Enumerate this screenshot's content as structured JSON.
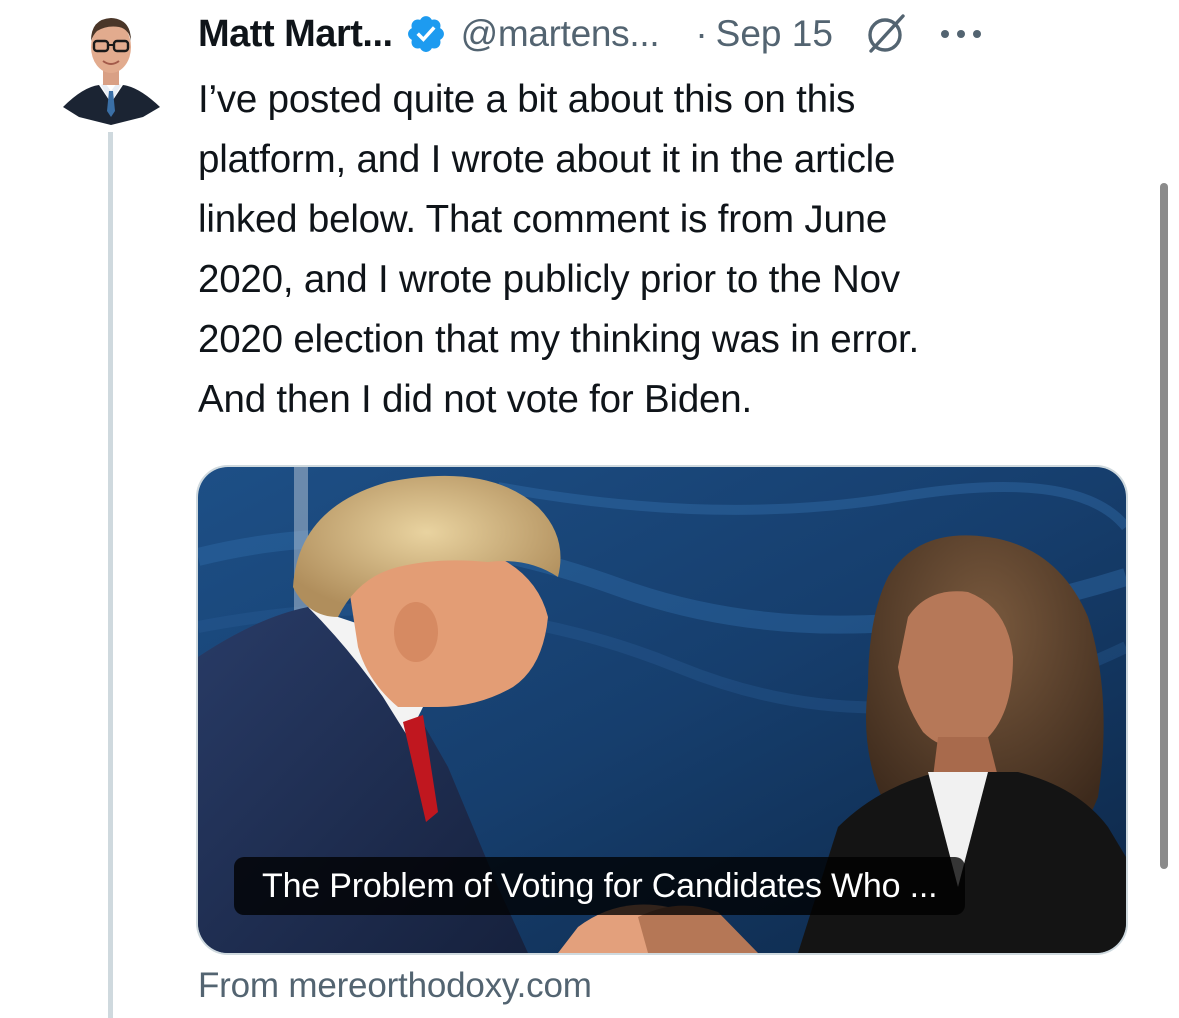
{
  "tweet": {
    "author_name": "Matt Mart...",
    "author_handle": "@martens...",
    "separator": "·",
    "date": "Sep 15",
    "verified": true,
    "text_lines": [
      "I’ve posted quite a bit about this on this",
      "platform, and I wrote about it in the article",
      "linked below. That comment is from June",
      "2020, and I wrote publicly prior to the Nov",
      "2020 election that my thinking was in error.",
      "And then I did not vote for Biden."
    ]
  },
  "link_card": {
    "title": "The Problem of Voting for Candidates Who ...",
    "source": "From mereorthodoxy.com"
  },
  "icons": {
    "verified": "verified-badge-icon",
    "grok": "grok-icon",
    "more": "more-options-icon"
  },
  "colors": {
    "text_primary": "#0f1419",
    "text_secondary": "#536471",
    "verified_blue": "#1d9bf0",
    "border": "#cfd9de"
  }
}
